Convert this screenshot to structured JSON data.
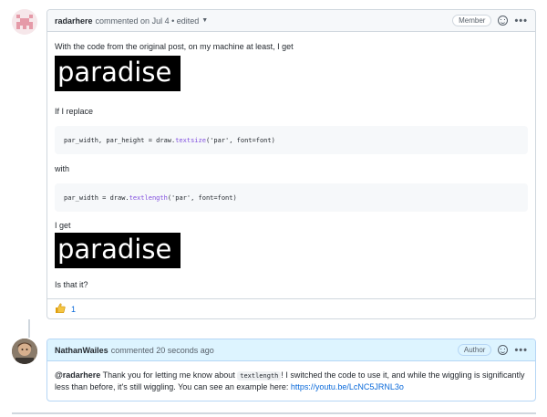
{
  "comment1": {
    "author": "radarhere",
    "meta": "commented on Jul 4 • edited",
    "badge": "Member",
    "intro": "With the code from the original post, on my machine at least, I get",
    "image1_text": "paradise",
    "replace_text": "If I replace",
    "code1": {
      "a": "par_width, par_height = draw.",
      "fn": "textsize",
      "b": "('par', font=font)"
    },
    "with_text": "with",
    "code2": {
      "a": "par_width = draw.",
      "fn": "textlength",
      "b": "('par', font=font)"
    },
    "iget_text": "I get",
    "image2_text": "paradise",
    "question": "Is that it?",
    "reaction_count": "1"
  },
  "comment2": {
    "author": "NathanWailes",
    "meta": "commented 20 seconds ago",
    "badge": "Author",
    "mention": "@radarhere",
    "text1": " Thank you for letting me know about ",
    "code": "textlength",
    "text2": "! I switched the code to use it, and while the wiggling is significantly",
    "text3": "less than before, it's still wiggling. You can see an example here: ",
    "link": "https://youtu.be/LcNC5JRNL3o"
  },
  "icons": [
    "avatar",
    "smiley-icon",
    "kebab-menu-icon",
    "caret-down-icon",
    "thumbs-up-icon"
  ],
  "colors": {
    "link": "#0969da",
    "border": "#d0d7de",
    "author_header": "#ddf4ff"
  }
}
